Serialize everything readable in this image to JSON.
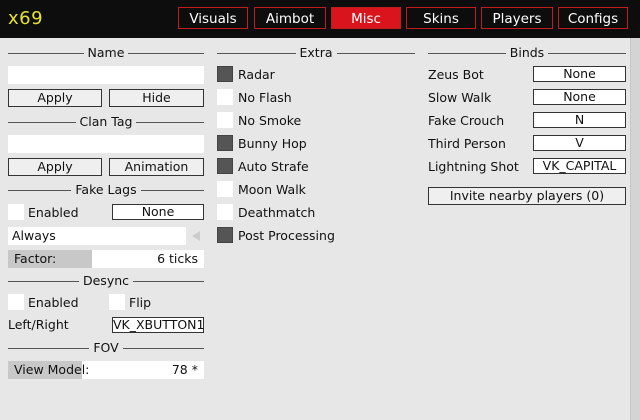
{
  "app": {
    "title": "x69"
  },
  "tabs": [
    {
      "label": "Visuals",
      "active": false
    },
    {
      "label": "Aimbot",
      "active": false
    },
    {
      "label": "Misc",
      "active": true
    },
    {
      "label": "Skins",
      "active": false
    },
    {
      "label": "Players",
      "active": false
    },
    {
      "label": "Configs",
      "active": false
    }
  ],
  "colors": {
    "accent": "#d9141c",
    "logo": "#e8e22a",
    "background": "#e7e7e7",
    "titlebar": "#0d0d0d"
  },
  "left": {
    "name": {
      "header": "Name",
      "value": "",
      "apply": "Apply",
      "hide": "Hide"
    },
    "clantag": {
      "header": "Clan Tag",
      "value": "",
      "apply": "Apply",
      "animation": "Animation"
    },
    "fakelags": {
      "header": "Fake Lags",
      "enabled_label": "Enabled",
      "enabled": false,
      "bind": "None",
      "mode": "Always",
      "factor_label": "Factor:",
      "factor_value": "6 ticks",
      "factor_fraction": 0.4
    },
    "desync": {
      "header": "Desync",
      "enabled_label": "Enabled",
      "enabled": false,
      "flip_label": "Flip",
      "flip": false,
      "leftright_label": "Left/Right",
      "leftright_bind": "VK_XBUTTON1"
    },
    "fov": {
      "header": "FOV",
      "viewmodel_label": "View Model:",
      "viewmodel_value": "78 *",
      "viewmodel_fraction": 0.38
    }
  },
  "extra": {
    "header": "Extra",
    "items": [
      {
        "label": "Radar",
        "checked": true
      },
      {
        "label": "No Flash",
        "checked": false
      },
      {
        "label": "No Smoke",
        "checked": false
      },
      {
        "label": "Bunny Hop",
        "checked": true
      },
      {
        "label": "Auto Strafe",
        "checked": true
      },
      {
        "label": "Moon Walk",
        "checked": false
      },
      {
        "label": "Deathmatch",
        "checked": false
      },
      {
        "label": "Post Processing",
        "checked": true
      }
    ]
  },
  "binds": {
    "header": "Binds",
    "items": [
      {
        "label": "Zeus Bot",
        "key": "None"
      },
      {
        "label": "Slow Walk",
        "key": "None"
      },
      {
        "label": "Fake Crouch",
        "key": "N"
      },
      {
        "label": "Third Person",
        "key": "V"
      },
      {
        "label": "Lightning Shot",
        "key": "VK_CAPITAL"
      }
    ],
    "invite": "Invite nearby players (0)"
  }
}
